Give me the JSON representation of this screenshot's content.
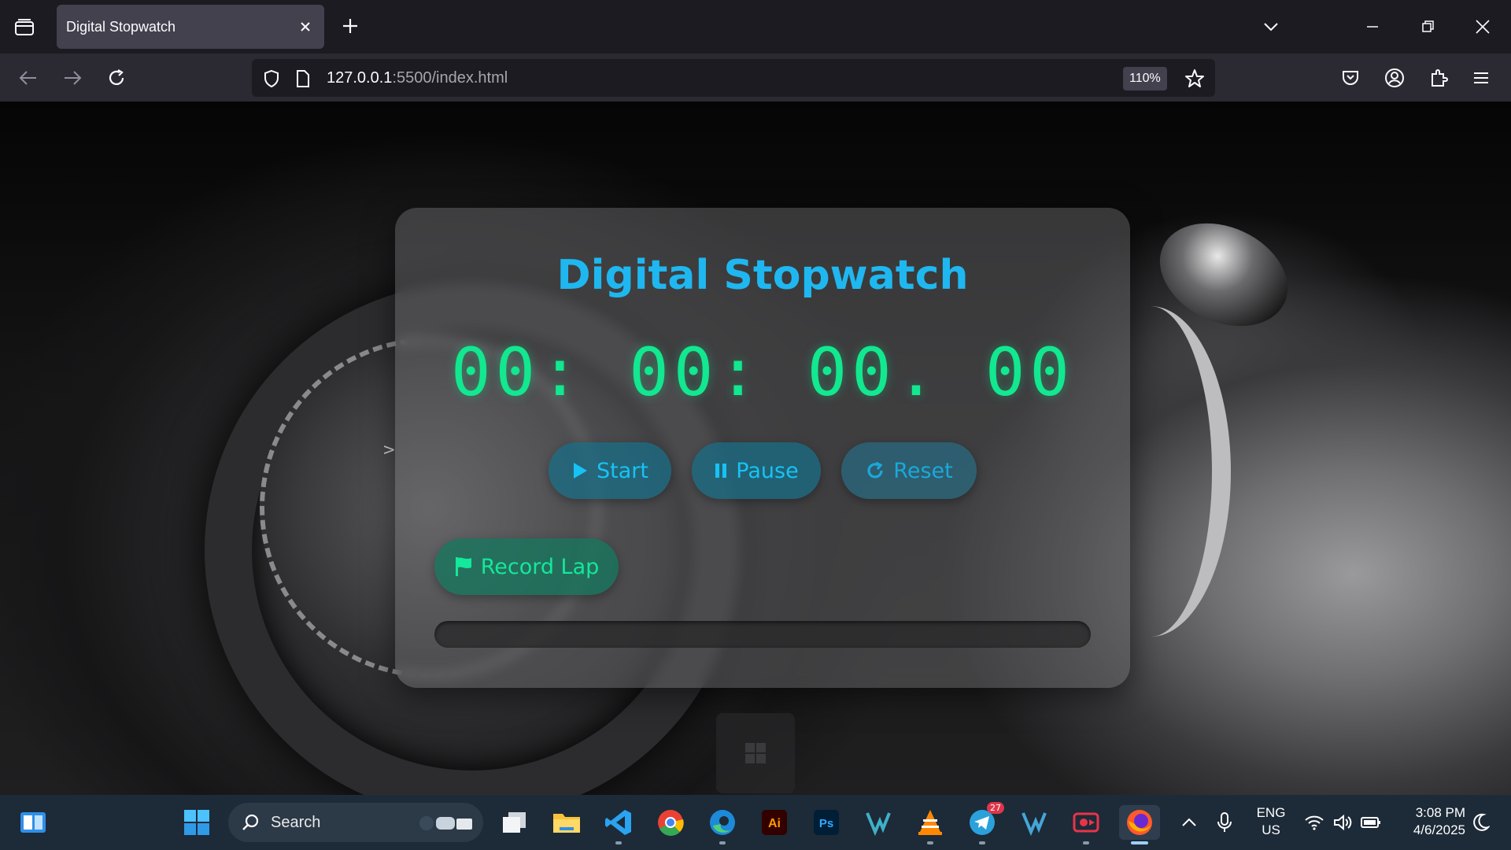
{
  "browser": {
    "tab_title": "Digital Stopwatch",
    "url_host": "127.0.0.1",
    "url_path": ":5500/index.html",
    "zoom": "110%"
  },
  "page": {
    "edge_arrow": ">",
    "title": "Digital Stopwatch",
    "timer_display": "00: 00: 00. 00",
    "buttons": {
      "start": "Start",
      "pause": "Pause",
      "reset": "Reset",
      "record_lap": "Record Lap"
    },
    "progress_percent": 0,
    "colors": {
      "title": "#1fb7f0",
      "timer": "#12e88f",
      "button_text": "#16c3f5",
      "lap_text": "#14e89a"
    }
  },
  "taskbar": {
    "search_placeholder": "Search",
    "telegram_badge": "27",
    "language": "ENG",
    "region": "US",
    "time": "3:08 PM",
    "date": "4/6/2025",
    "apps": [
      "widgets",
      "start",
      "search",
      "task-view",
      "file-explorer",
      "vscode",
      "chrome",
      "edge",
      "illustrator",
      "photoshop",
      "vscode-insiders",
      "vlc",
      "telegram",
      "vscode-alt",
      "screen-recorder",
      "firefox"
    ]
  }
}
